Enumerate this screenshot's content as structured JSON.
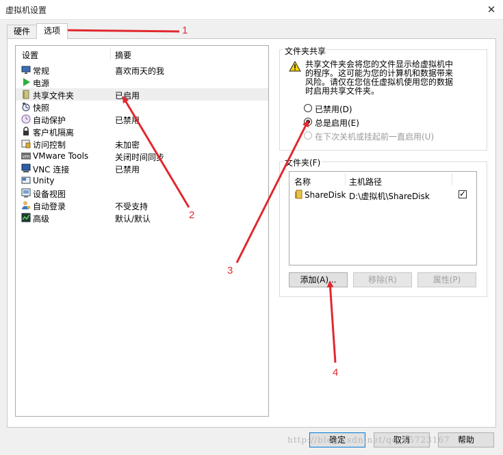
{
  "window": {
    "title": "虚拟机设置",
    "close_glyph": "✕"
  },
  "tabs": [
    {
      "label": "硬件"
    },
    {
      "label": "选项"
    }
  ],
  "settings": {
    "col_setting": "设置",
    "col_summary": "摘要",
    "items": [
      {
        "label": "常规",
        "summary": "喜欢雨天的我",
        "icon": "monitor-icon"
      },
      {
        "label": "电源",
        "summary": "",
        "icon": "play-icon"
      },
      {
        "label": "共享文件夹",
        "summary": "已启用",
        "icon": "folder-share-icon"
      },
      {
        "label": "快照",
        "summary": "",
        "icon": "snapshot-icon"
      },
      {
        "label": "自动保护",
        "summary": "已禁用",
        "icon": "clock-icon"
      },
      {
        "label": "客户机隔离",
        "summary": "",
        "icon": "isolation-icon"
      },
      {
        "label": "访问控制",
        "summary": "未加密",
        "icon": "lock-icon"
      },
      {
        "label": "VMware Tools",
        "summary": "关闭时间同步",
        "icon": "vm-icon"
      },
      {
        "label": "VNC 连接",
        "summary": "已禁用",
        "icon": "vnc-icon"
      },
      {
        "label": "Unity",
        "summary": "",
        "icon": "unity-icon"
      },
      {
        "label": "设备视图",
        "summary": "",
        "icon": "device-view-icon"
      },
      {
        "label": "自动登录",
        "summary": "不受支持",
        "icon": "user-icon"
      },
      {
        "label": "高级",
        "summary": "默认/默认",
        "icon": "chart-icon"
      }
    ]
  },
  "sharing": {
    "group_title": "文件夹共享",
    "warning_lines": [
      "共享文件夹会将您的文件显示给虚拟机中",
      "的程序。这可能为您的计算机和数据带来",
      "风险。请仅在您信任虚拟机使用您的数据",
      "时启用共享文件夹。"
    ],
    "options": [
      {
        "label": "已禁用(D)",
        "selected": false,
        "disabled": false
      },
      {
        "label": "总是启用(E)",
        "selected": true,
        "disabled": false
      },
      {
        "label": "在下次关机或挂起前一直启用(U)",
        "selected": false,
        "disabled": true
      }
    ]
  },
  "folders": {
    "group_title": "文件夹(F)",
    "col_name": "名称",
    "col_path": "主机路径",
    "rows": [
      {
        "name": "ShareDisk",
        "path": "D:\\虚拟机\\ShareDisk",
        "checked": true
      }
    ],
    "check_glyph": "✓",
    "add_label": "添加(A)...",
    "remove_label": "移除(R)",
    "properties_label": "属性(P)"
  },
  "footer": {
    "ok_label": "确定",
    "cancel_label": "取消",
    "help_label": "帮助"
  },
  "watermark": "http://blog.csdn.net/qq_15723167",
  "annotations": [
    "1",
    "2",
    "3",
    "4"
  ],
  "colors": {
    "annotation": "#e0282e",
    "selection": "#e5f3ff",
    "accent": "#0078d7"
  }
}
